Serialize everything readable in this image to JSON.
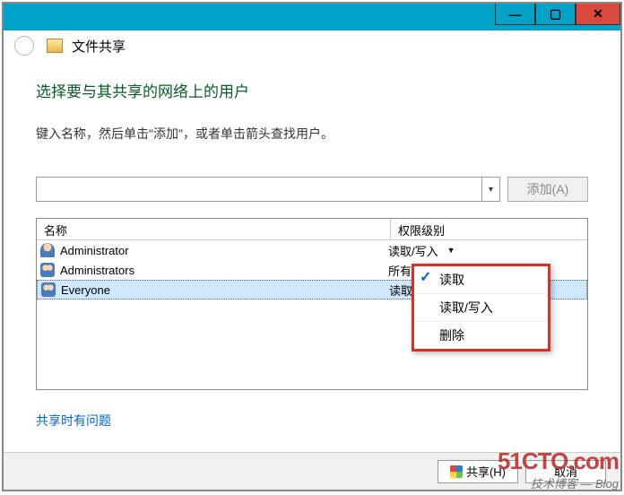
{
  "window": {
    "title": "文件共享"
  },
  "page": {
    "heading": "选择要与其共享的网络上的用户",
    "instruction": "键入名称，然后单击\"添加\"，或者单击箭头查找用户。",
    "add_button": "添加(A)"
  },
  "grid": {
    "columns": {
      "name": "名称",
      "permission": "权限级别"
    },
    "rows": [
      {
        "icon": "single",
        "name": "Administrator",
        "permission": "读取/写入",
        "has_dropdown": true,
        "selected": false
      },
      {
        "icon": "group",
        "name": "Administrators",
        "permission": "所有者",
        "has_dropdown": false,
        "selected": false
      },
      {
        "icon": "group",
        "name": "Everyone",
        "permission": "读取",
        "has_dropdown": true,
        "selected": true
      }
    ]
  },
  "dropdown": {
    "items": [
      {
        "label": "读取",
        "checked": true
      },
      {
        "label": "读取/写入",
        "checked": false
      },
      {
        "label": "删除",
        "checked": false
      }
    ]
  },
  "help_link": "共享时有问题",
  "footer": {
    "share_button": "共享(H)",
    "cancel_button": "取消"
  },
  "watermark": {
    "site": "51CTO.com",
    "tag": "技术博客",
    "suffix": "Blog"
  }
}
